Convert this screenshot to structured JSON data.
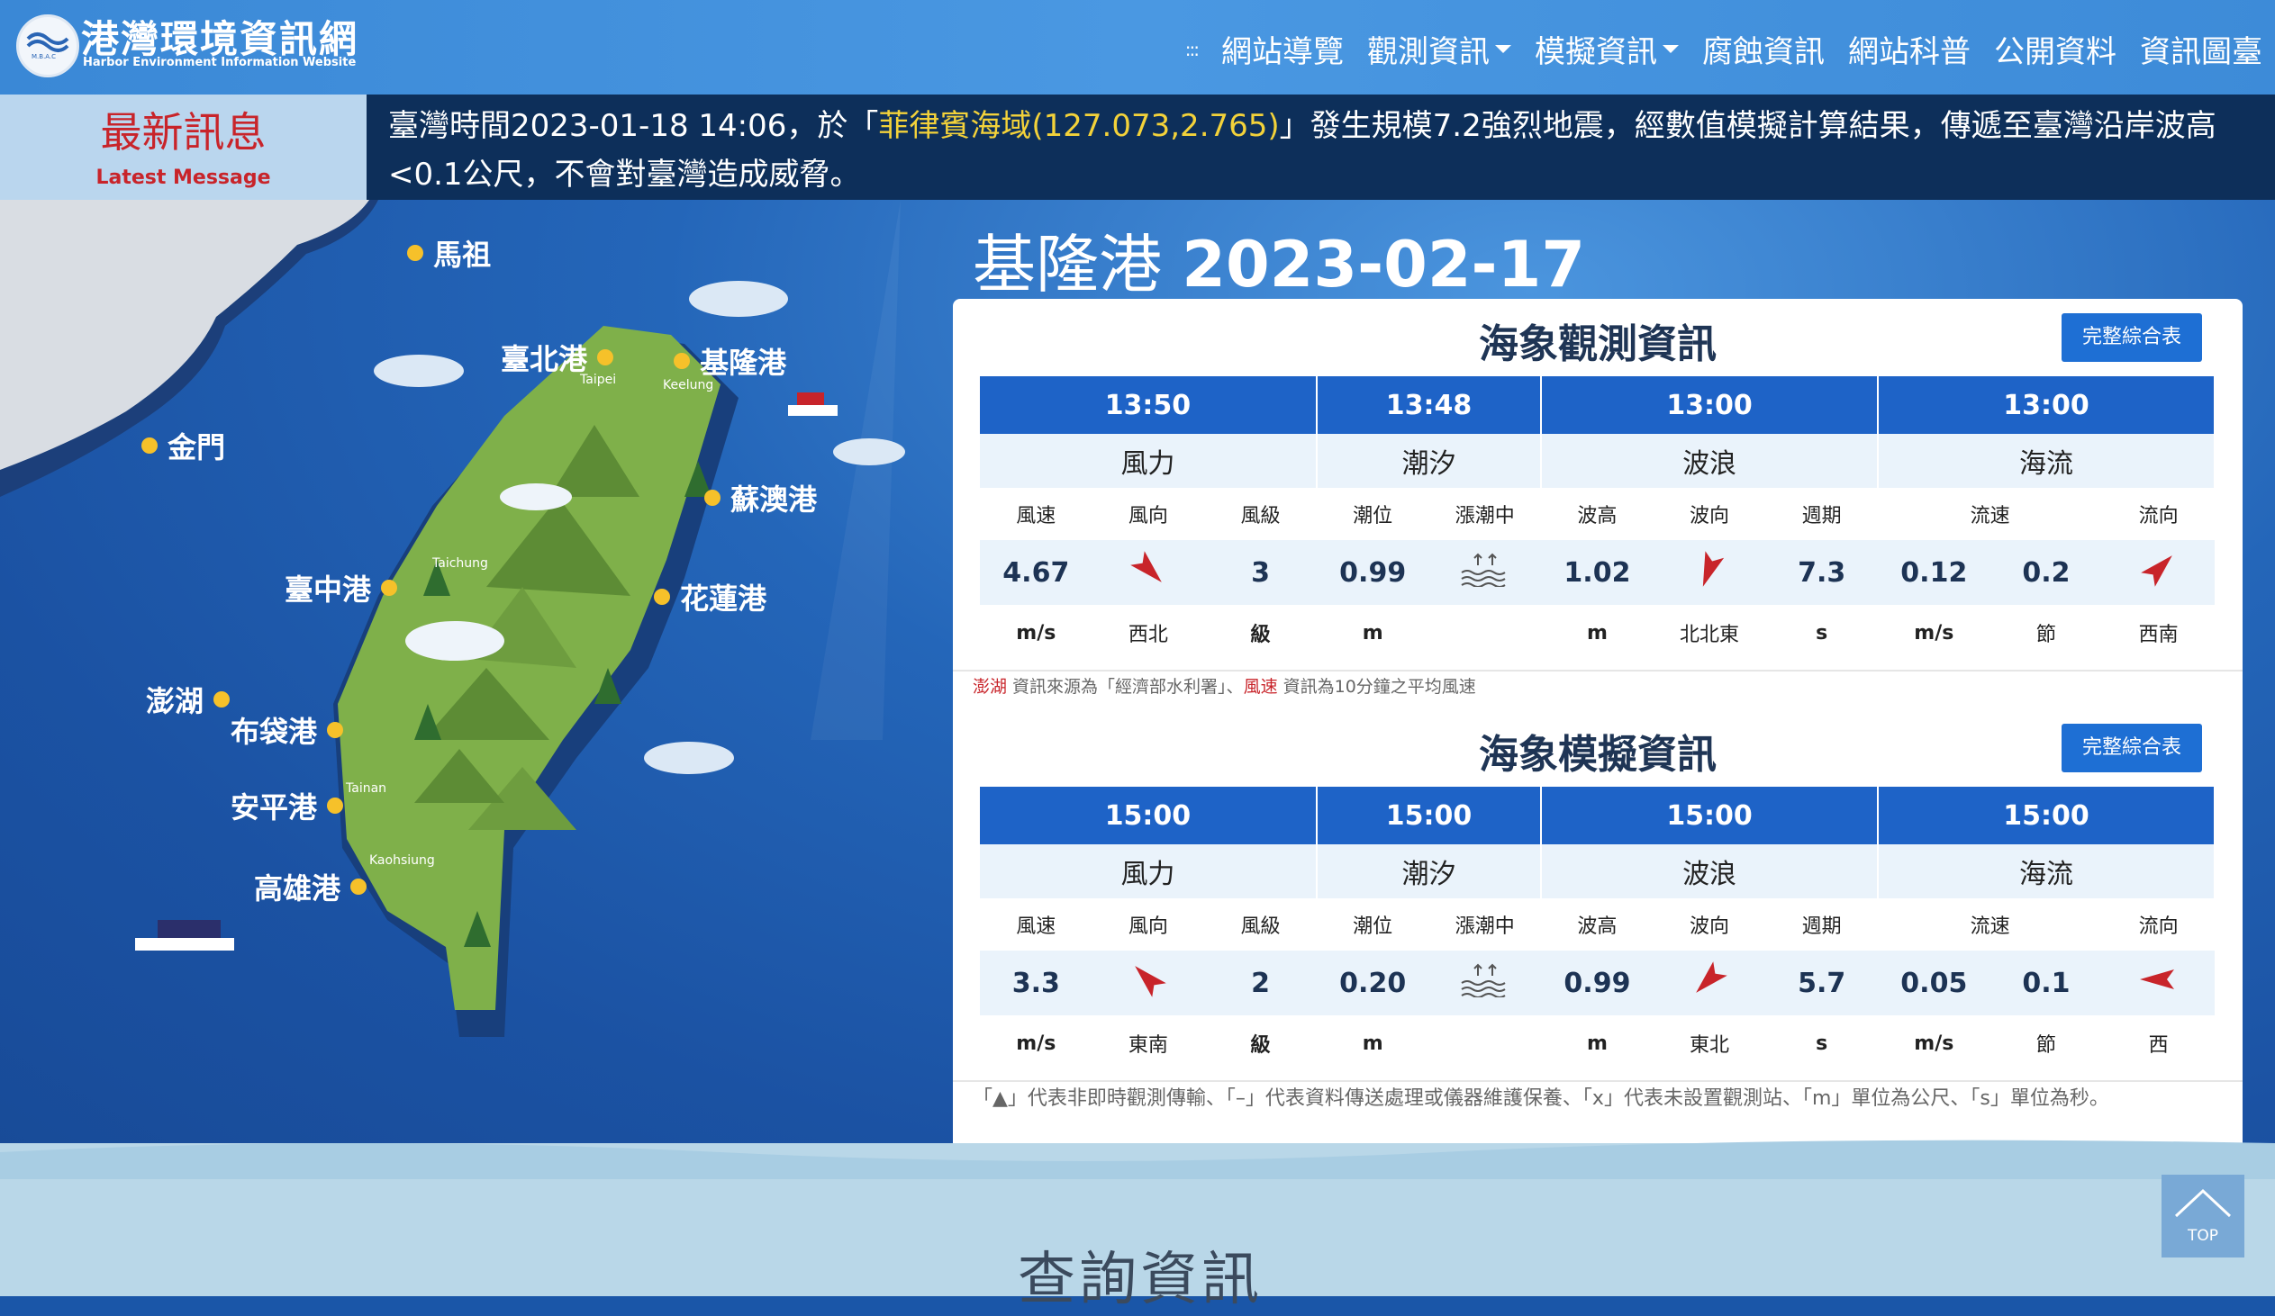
{
  "header": {
    "logo_title": "港灣環境資訊網",
    "logo_subtitle": "Harbor Environment Information Website",
    "logo_badge": "M.B.A.C",
    "nav_dots": ":::",
    "nav": [
      {
        "label": "網站導覽"
      },
      {
        "label": "觀測資訊"
      },
      {
        "label": "模擬資訊"
      },
      {
        "label": "腐蝕資訊"
      },
      {
        "label": "網站科普"
      },
      {
        "label": "公開資料"
      },
      {
        "label": "資訊圖臺"
      }
    ]
  },
  "message": {
    "label_zh": "最新訊息",
    "label_en": "Latest Message",
    "text_before": "臺灣時間2023-01-18 14:06，於「",
    "highlight": "菲律賓海域(127.073,2.765)",
    "text_after": "」發生規模7.2強烈地震，經數值模擬計算結果，傳遞至臺灣沿岸波高<0.1公尺，不會對臺灣造成威脅。"
  },
  "map": {
    "ports": [
      {
        "name": "馬祖"
      },
      {
        "name": "金門"
      },
      {
        "name": "臺北港"
      },
      {
        "name": "基隆港"
      },
      {
        "name": "蘇澳港"
      },
      {
        "name": "花蓮港"
      },
      {
        "name": "臺中港"
      },
      {
        "name": "澎湖"
      },
      {
        "name": "布袋港"
      },
      {
        "name": "安平港"
      },
      {
        "name": "高雄港"
      }
    ],
    "cities": [
      "Taipei",
      "Keelung",
      "Taichung",
      "Tainan",
      "Kaohsiung"
    ]
  },
  "port": {
    "name": "基隆港",
    "date": "2023-02-17"
  },
  "observation": {
    "title": "海象觀測資訊",
    "button": "完整綜合表",
    "times": [
      "13:50",
      "13:48",
      "13:00",
      "13:00"
    ],
    "categories": [
      "風力",
      "潮汐",
      "波浪",
      "海流"
    ],
    "headers": [
      "風速",
      "風向",
      "風級",
      "潮位",
      "漲潮中",
      "波高",
      "波向",
      "週期",
      "流速",
      "",
      "流向"
    ],
    "values": {
      "wind_speed": "4.67",
      "wind_level": "3",
      "tide": "0.99",
      "wave_height": "1.02",
      "period": "7.3",
      "current_speed": "0.12",
      "current_knots": "0.2"
    },
    "units": {
      "wind_speed": "m/s",
      "wind_dir": "西北",
      "wind_level": "級",
      "tide": "m",
      "wave_height": "m",
      "wave_dir": "北北東",
      "period": "s",
      "current_speed": "m/s",
      "current_knots": "節",
      "current_dir": "西南"
    },
    "note_a_red": "澎湖",
    "note_a": " 資訊來源為「經濟部水利署」、",
    "note_b_red": "風速",
    "note_b": " 資訊為10分鐘之平均風速"
  },
  "simulation": {
    "title": "海象模擬資訊",
    "button": "完整綜合表",
    "times": [
      "15:00",
      "15:00",
      "15:00",
      "15:00"
    ],
    "categories": [
      "風力",
      "潮汐",
      "波浪",
      "海流"
    ],
    "headers": [
      "風速",
      "風向",
      "風級",
      "潮位",
      "漲潮中",
      "波高",
      "波向",
      "週期",
      "流速",
      "",
      "流向"
    ],
    "values": {
      "wind_speed": "3.3",
      "wind_level": "2",
      "tide": "0.20",
      "wave_height": "0.99",
      "period": "5.7",
      "current_speed": "0.05",
      "current_knots": "0.1"
    },
    "units": {
      "wind_speed": "m/s",
      "wind_dir": "東南",
      "wind_level": "級",
      "tide": "m",
      "wave_height": "m",
      "wave_dir": "東北",
      "period": "s",
      "current_speed": "m/s",
      "current_knots": "節",
      "current_dir": "西"
    },
    "legend_note": "「▲」代表非即時觀測傳輸、「–」代表資料傳送處理或儀器維護保養、「x」代表未設置觀測站、「m」單位為公尺、「s」單位為秒。"
  },
  "bottom": {
    "query_title": "查詢資訊",
    "top_button": "TOP"
  },
  "colors": {
    "header": "#3a88d6",
    "message_bg": "#0d2f5a",
    "highlight": "#f3d23a",
    "table_head": "#1e63c7",
    "arrow": "#c8242a"
  }
}
